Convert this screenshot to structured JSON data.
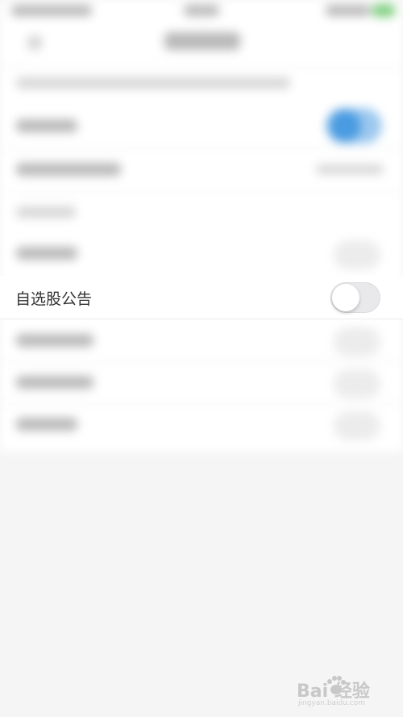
{
  "settings": {
    "focused_row": {
      "label": "自选股公告",
      "toggle_on": false
    }
  },
  "colors": {
    "background": "#f5f5f5",
    "accent_toggle_on": "#4a9be1",
    "toggle_off_track": "#e9e9eb"
  },
  "watermark": {
    "logo_text": "Bai  经验",
    "url": "jingyan.baidu.com"
  }
}
